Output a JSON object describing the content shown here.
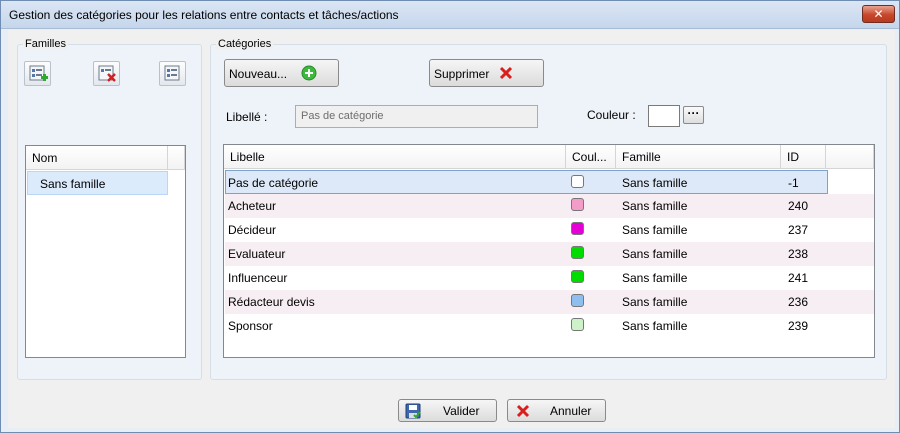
{
  "window": {
    "title": "Gestion des catégories pour les relations entre contacts et tâches/actions",
    "close_glyph": "✕"
  },
  "familles": {
    "group_label": "Familles",
    "toolbar": [
      "add-family-icon",
      "delete-family-icon",
      "edit-family-icon"
    ],
    "column_header": "Nom",
    "items": [
      "Sans famille"
    ]
  },
  "categories": {
    "group_label": "Catégories",
    "new_button": "Nouveau...",
    "delete_button": "Supprimer",
    "libelle_label": "Libellé :",
    "libelle_value": "Pas de catégorie",
    "couleur_label": "Couleur :",
    "couleur_browse": "···",
    "columns": [
      "Libelle",
      "Coul...",
      "Famille",
      "ID"
    ],
    "rows": [
      {
        "libelle": "Pas de catégorie",
        "color": "#ffffff",
        "famille": "Sans famille",
        "id": "-1"
      },
      {
        "libelle": "Acheteur",
        "color": "#f29cc7",
        "famille": "Sans famille",
        "id": "240"
      },
      {
        "libelle": "Décideur",
        "color": "#e600d8",
        "famille": "Sans famille",
        "id": "237"
      },
      {
        "libelle": "Evaluateur",
        "color": "#00dc00",
        "famille": "Sans famille",
        "id": "238"
      },
      {
        "libelle": "Influenceur",
        "color": "#00dc00",
        "famille": "Sans famille",
        "id": "241"
      },
      {
        "libelle": "Rédacteur devis",
        "color": "#8fbfee",
        "famille": "Sans famille",
        "id": "236"
      },
      {
        "libelle": "Sponsor",
        "color": "#cdf2c9",
        "famille": "Sans famille",
        "id": "239"
      }
    ]
  },
  "footer": {
    "validate_button": "Valider",
    "cancel_button": "Annuler"
  }
}
